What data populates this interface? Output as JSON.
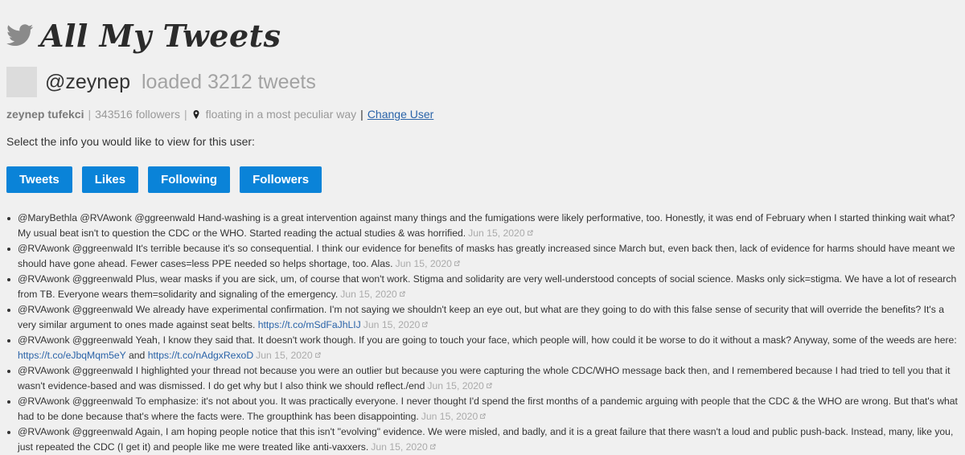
{
  "app": {
    "title": "All My Tweets",
    "logo_icon": "twitter-bird-icon"
  },
  "user": {
    "handle": "@zeynep",
    "loaded": "loaded 3212 tweets",
    "name": "zeynep tufekci",
    "followers": "343516 followers",
    "location": "floating in a most peculiar way",
    "change_user": "Change User"
  },
  "prompt": "Select the info you would like to view for this user:",
  "buttons": [
    "Tweets",
    "Likes",
    "Following",
    "Followers"
  ],
  "colors": {
    "accent": "#0a83d8",
    "link": "#2a63a8",
    "muted": "#aaaaaa"
  },
  "tweets": [
    {
      "parts": [
        {
          "text": "@MaryBethla @RVAwonk @ggreenwald Hand-washing is a great intervention against many things and the fumigations were likely performative, too. Honestly, it was end of February when I started thinking wait what? My usual beat isn't to question the CDC or the WHO. Started reading the actual studies & was horrified."
        }
      ],
      "date": "Jun 15, 2020"
    },
    {
      "parts": [
        {
          "text": "@RVAwonk @ggreenwald It's terrible because it's so consequential. I think our evidence for benefits of masks has greatly increased since March but, even back then, lack of evidence for harms should have meant we should have gone ahead. Fewer cases=less PPE needed so helps shortage, too. Alas."
        }
      ],
      "date": "Jun 15, 2020"
    },
    {
      "parts": [
        {
          "text": "@RVAwonk @ggreenwald Plus, wear masks if you are sick, um, of course that won't work. Stigma and solidarity are very well-understood concepts of social science. Masks only sick=stigma. We have a lot of research from TB. Everyone wears them=solidarity and signaling of the emergency."
        }
      ],
      "date": "Jun 15, 2020"
    },
    {
      "parts": [
        {
          "text": "@RVAwonk @ggreenwald We already have experimental confirmation. I'm not saying we shouldn't keep an eye out, but what are they going to do with this false sense of security that will override the benefits? It's a very similar argument to ones made against seat belts. "
        },
        {
          "text": "https://t.co/mSdFaJhLIJ",
          "link": true
        }
      ],
      "date": "Jun 15, 2020"
    },
    {
      "parts": [
        {
          "text": "@RVAwonk @ggreenwald Yeah, I know they said that. It doesn't work though. If you are going to touch your face, which people will, how could it be worse to do it without a mask? Anyway, some of the weeds are here: "
        },
        {
          "text": "https://t.co/eJbqMqm5eY",
          "link": true
        },
        {
          "text": " and "
        },
        {
          "text": "https://t.co/nAdgxRexoD",
          "link": true
        }
      ],
      "date": "Jun 15, 2020"
    },
    {
      "parts": [
        {
          "text": "@RVAwonk @ggreenwald I highlighted your thread not because you were an outlier but because you were capturing the whole CDC/WHO message back then, and I remembered because I had tried to tell you that it wasn't evidence-based and was dismissed. I do get why but I also think we should reflect./end"
        }
      ],
      "date": "Jun 15, 2020"
    },
    {
      "parts": [
        {
          "text": "@RVAwonk @ggreenwald To emphasize: it's not about you. It was practically everyone. I never thought I'd spend the first months of a pandemic arguing with people that the CDC & the WHO are wrong. But that's what had to be done because that's where the facts were. The groupthink has been disappointing."
        }
      ],
      "date": "Jun 15, 2020"
    },
    {
      "parts": [
        {
          "text": "@RVAwonk @ggreenwald Again, I am hoping people notice that this isn't \"evolving\" evidence. We were misled, and badly, and it is a great failure that there wasn't a loud and public push-back. Instead, many, like you, just repeated the CDC (I get it) and people like me were treated like anti-vaxxers."
        }
      ],
      "date": "Jun 15, 2020"
    }
  ]
}
